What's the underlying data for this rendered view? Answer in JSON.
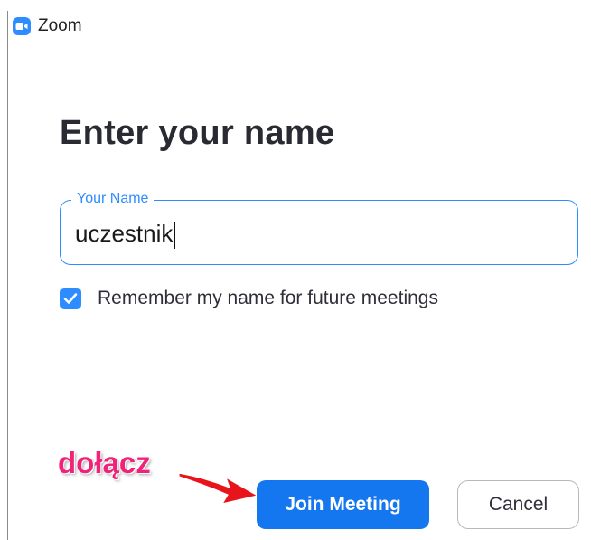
{
  "window": {
    "title": "Zoom",
    "logo_icon": "zoom-camera-icon"
  },
  "dialog": {
    "heading": "Enter your name",
    "name_field": {
      "label": "Your Name",
      "value": "uczestnik"
    },
    "remember": {
      "label": "Remember my name for future meetings",
      "checked": true
    },
    "buttons": {
      "join_label": "Join Meeting",
      "cancel_label": "Cancel"
    }
  },
  "annotation": {
    "text": "dołącz",
    "color": "#f0227a",
    "arrow_color": "#e8141c"
  },
  "colors": {
    "accent": "#2d8cff",
    "primary_button": "#1477f0"
  }
}
